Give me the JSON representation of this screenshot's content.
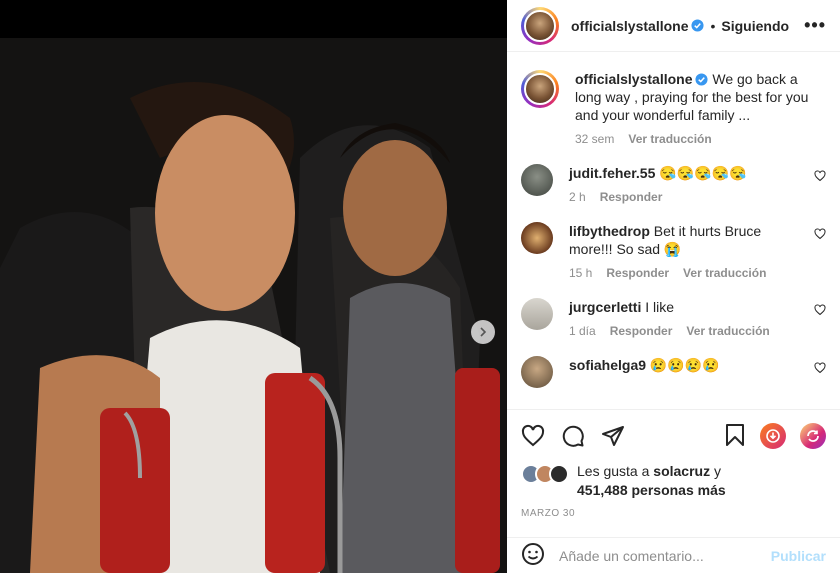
{
  "header": {
    "username": "officialslystallone",
    "follow_label": "Siguiendo",
    "more_label": "•••"
  },
  "caption": {
    "username": "officialslystallone",
    "text": "We go back a long way , praying for the best for you and your wonderful family ...",
    "time": "32 sem",
    "translate": "Ver traducción"
  },
  "comments": [
    {
      "username": "judit.feher.55",
      "text": "😪😪😪😪😪",
      "time": "2 h",
      "reply": "Responder",
      "translate": ""
    },
    {
      "username": "lifbythedrop",
      "text": "Bet it hurts Bruce more!!! So sad 😭",
      "time": "15 h",
      "reply": "Responder",
      "translate": "Ver traducción"
    },
    {
      "username": "jurgcerletti",
      "text": "I like",
      "time": "1 día",
      "reply": "Responder",
      "translate": "Ver traducción"
    },
    {
      "username": "sofiahelga9",
      "text": "😢😢😢😢",
      "time": "",
      "reply": "",
      "translate": ""
    }
  ],
  "likes": {
    "prefix": "Les gusta a",
    "user": "solacruz",
    "and": "y",
    "count": "451,488 personas más"
  },
  "date": "MARZO 30",
  "add_comment": {
    "placeholder": "Añade un comentario...",
    "publish": "Publicar"
  },
  "colors": {
    "verified": "#3897f0",
    "muted": "#8e8e8e",
    "publish_disabled": "#b2dffc"
  }
}
